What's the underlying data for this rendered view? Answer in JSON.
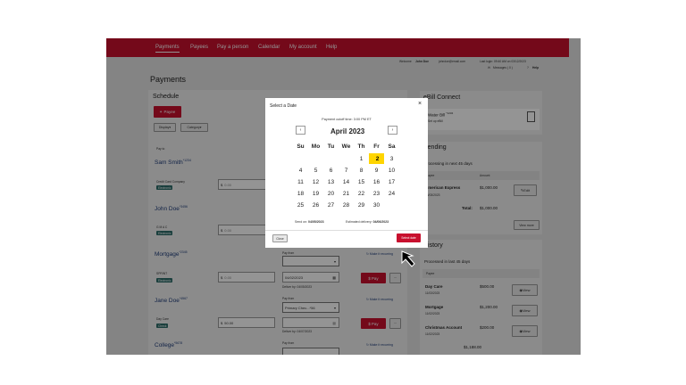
{
  "nav": {
    "items": [
      "Payments",
      "Payees",
      "Pay a person",
      "Calendar",
      "My account",
      "Help"
    ]
  },
  "userbar": {
    "welcome": "Welcome",
    "user": "John Doe",
    "email": "johndoe@email.com",
    "lastlogin": "Last login: 09:40 AM on 03/12/2023",
    "messages": "Messages ( 0 )",
    "help": "Help"
  },
  "page": {
    "title": "Payments"
  },
  "schedule": {
    "title": "Schedule",
    "payee_btn": "Payee",
    "display_btn": "Display",
    "category_btn": "Category",
    "payto": "Pay to"
  },
  "payees": [
    {
      "name": "Sam Smith",
      "acct": "*1234",
      "type_label": "Credit Card Company",
      "badge": "Electronic",
      "amount": "0.00"
    },
    {
      "name": "John Doe",
      "acct": "*3456",
      "type_label": "G M A C",
      "badge": "Electronic",
      "amount": "0.00"
    },
    {
      "name": "Mortgage",
      "acct": "*2345",
      "type_label": "SPRINT",
      "badge": "Electronic",
      "amount": "0.00",
      "payfrom": "Pay from",
      "date": "04/02/2023",
      "deliver": "Deliver by: 04/05/2023",
      "pay": "Pay",
      "recurring": "Make it recurring"
    },
    {
      "name": "Jane Doe",
      "acct": "*4567",
      "type_label": "Day Care",
      "badge": "Check",
      "amount": "50.00",
      "payfrom": "Pay from",
      "account": "Primary Chec...*56",
      "deliver": "Deliver by: 04/07/2023",
      "pay": "Pay",
      "recurring": "Make it recurring"
    },
    {
      "name": "College",
      "acct": "*5678",
      "payfrom": "Pay from",
      "recurring": "Make it recurring"
    }
  ],
  "ebill": {
    "title": "eBill Connect",
    "name": "Water Bill",
    "acct": "*1234",
    "setup": "Set up eBill"
  },
  "pending": {
    "title": "Pending",
    "subtitle": "Processing in next 45 days",
    "col_payee": "Payee",
    "col_amount": "Amount",
    "payee": "American Express",
    "date": "04/03/2023",
    "amount": "$1,000.00",
    "edit": "Edit",
    "total_label": "Total:",
    "total": "$1,000.00",
    "viewmore": "View more"
  },
  "history": {
    "title": "History",
    "subtitle": "Processed in last 45 days",
    "col_payee": "Payee",
    "items": [
      {
        "name": "Day Care",
        "date": "11/03/2023",
        "amount": "$500.00",
        "view": "View"
      },
      {
        "name": "Mortgage",
        "date": "11/02/2023",
        "amount": "$1,200.00",
        "view": "View"
      },
      {
        "name": "Christmas Account",
        "date": "11/02/2023",
        "amount": "$200.00",
        "view": "View"
      }
    ],
    "total": "$1,188.00"
  },
  "modal": {
    "title": "Select a Date",
    "cutoff": "Payment cutoff time: 3:00 PM ET",
    "month": "April 2023",
    "dow": [
      "Su",
      "Mo",
      "Tu",
      "We",
      "Th",
      "Fr",
      "Sa"
    ],
    "weeks": [
      [
        "",
        "",
        "",
        "",
        "1",
        "2",
        "3"
      ],
      [
        "4",
        "5",
        "6",
        "7",
        "8",
        "9",
        "10"
      ],
      [
        "11",
        "12",
        "13",
        "14",
        "15",
        "16",
        "17"
      ],
      [
        "18",
        "19",
        "20",
        "21",
        "22",
        "23",
        "24"
      ],
      [
        "25",
        "26",
        "27",
        "28",
        "29",
        "30",
        ""
      ]
    ],
    "send_label": "Send on:",
    "send_date": "04/05/2023",
    "delivery_label": "Estimated delivery:",
    "delivery_date": "04/06/2023",
    "close": "Close",
    "select": "Select date"
  },
  "colors": {
    "brand": "#c8102e",
    "selected_day": "#ffd500",
    "badge": "#2d6d6a"
  }
}
